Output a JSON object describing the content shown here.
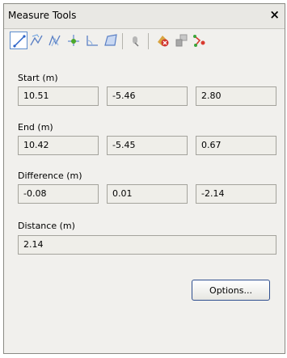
{
  "window": {
    "title": "Measure Tools",
    "close_glyph": "×"
  },
  "toolbar": {
    "tools": [
      {
        "name": "point-to-point-icon",
        "active": true
      },
      {
        "name": "point-line-icon",
        "active": false
      },
      {
        "name": "point-path-icon",
        "active": false
      },
      {
        "name": "shortest-distance-icon",
        "active": false
      },
      {
        "name": "angle-icon",
        "active": false
      },
      {
        "name": "area-icon",
        "active": false
      },
      {
        "name": "lock-icon",
        "active": false
      },
      {
        "name": "clear-icon",
        "active": false
      },
      {
        "name": "transform-icon",
        "active": false
      },
      {
        "name": "convert-to-redline-icon",
        "active": false
      }
    ]
  },
  "start": {
    "label": "Start (m)",
    "x": "10.51",
    "y": "-5.46",
    "z": "2.80"
  },
  "end": {
    "label": "End (m)",
    "x": "10.42",
    "y": "-5.45",
    "z": "0.67"
  },
  "difference": {
    "label": "Difference (m)",
    "x": "-0.08",
    "y": "0.01",
    "z": "-2.14"
  },
  "distance": {
    "label": "Distance (m)",
    "value": "2.14"
  },
  "options_button": {
    "label": "Options..."
  },
  "colors": {
    "panel_bg": "#f1f0ed",
    "field_bg": "#efeee9",
    "active_border": "#5c8ccd"
  }
}
